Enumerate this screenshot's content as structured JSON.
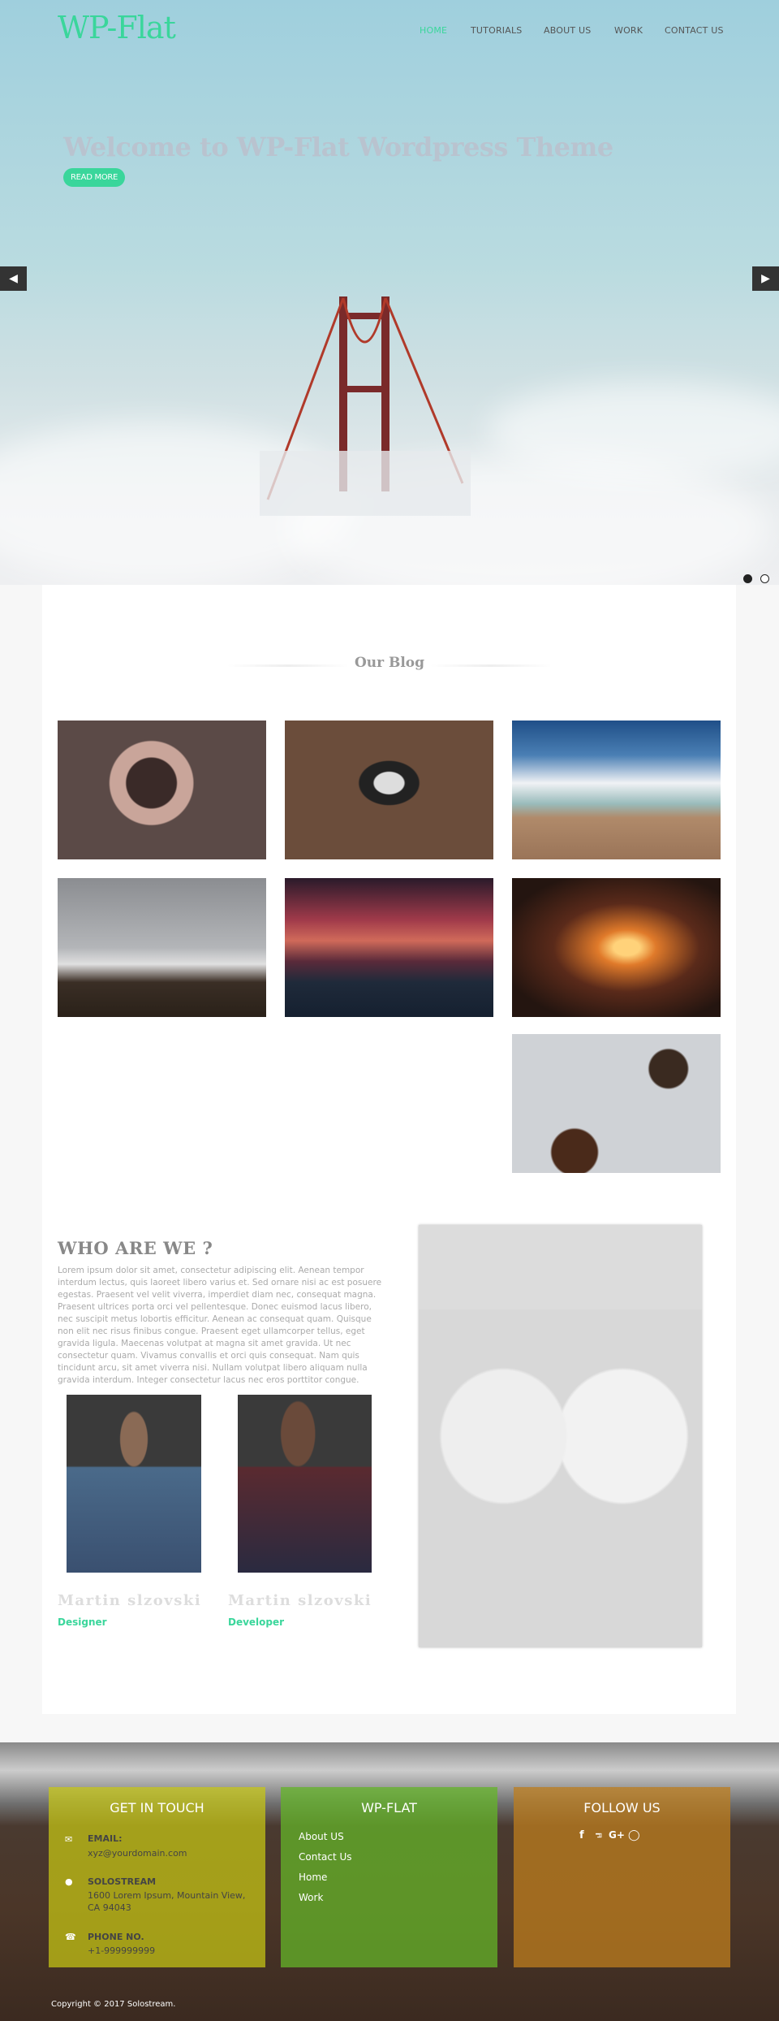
{
  "header": {
    "logo": "WP-Flat",
    "nav": [
      {
        "label": "HOME",
        "active": true
      },
      {
        "label": "TUTORIALS"
      },
      {
        "label": "ABOUT US"
      },
      {
        "label": "WORK"
      },
      {
        "label": "CONTACT US"
      }
    ]
  },
  "hero": {
    "title": "Welcome to WP-Flat Wordpress Theme",
    "button": "READ MORE",
    "prev_icon": "chevron-left",
    "next_icon": "chevron-right",
    "slides": 2,
    "active_slide": 1
  },
  "blog": {
    "title": "Our Blog",
    "images": [
      "hands-holding-pinecones",
      "phone-with-earphones",
      "snowy-mountain-sky",
      "misty-mountain-landscape",
      "sunset-silhouette",
      "concert-crowd-lights",
      "flatlay-accessories"
    ]
  },
  "about": {
    "title": "WHO ARE WE ?",
    "text": "Lorem ipsum dolor sit amet, consectetur adipiscing elit. Aenean tempor interdum lectus, quis laoreet libero varius et. Sed ornare nisi ac est posuere egestas. Praesent vel velit viverra, imperdiet diam nec, consequat magna. Praesent ultrices porta orci vel pellentesque. Donec euismod lacus libero, nec suscipit metus lobortis efficitur. Aenean ac consequat quam. Quisque non elit nec risus finibus congue. Praesent eget ullamcorper tellus, eget gravida ligula. Maecenas volutpat at magna sit amet gravida. Ut nec consectetur quam. Vivamus convallis et orci quis consequat. Nam quis tincidunt arcu, sit amet viverra nisi. Nullam volutpat libero aliquam nulla gravida interdum. Integer consectetur lacus nec eros porttitor congue.",
    "team": [
      {
        "name": "Martin slzovski",
        "role": "Designer"
      },
      {
        "name": "Martin slzovski",
        "role": "Developer"
      }
    ]
  },
  "footer": {
    "contact": {
      "title": "GET IN TOUCH",
      "email_label": "EMAIL:",
      "email": "xyz@yourdomain.com",
      "company": "SOLOSTREAM",
      "address_1": "1600 Lorem Ipsum, Mountain View,",
      "address_2": "CA 94043",
      "phone_label": "PHONE NO.",
      "phone": "+1-999999999"
    },
    "links": {
      "title": "WP-FLAT",
      "items": [
        "About US",
        "Contact Us",
        "Home",
        "Work"
      ]
    },
    "social": {
      "title": "FOLLOW US",
      "icons": [
        "f",
        "t",
        "G+",
        "ig"
      ]
    },
    "copyright": "Copyright © 2017 Solostream."
  },
  "colors": {
    "accent": "#3ad69b",
    "box_yellow": "#b5b81e",
    "box_green": "#5ea62a",
    "box_orange": "#b87a20"
  }
}
